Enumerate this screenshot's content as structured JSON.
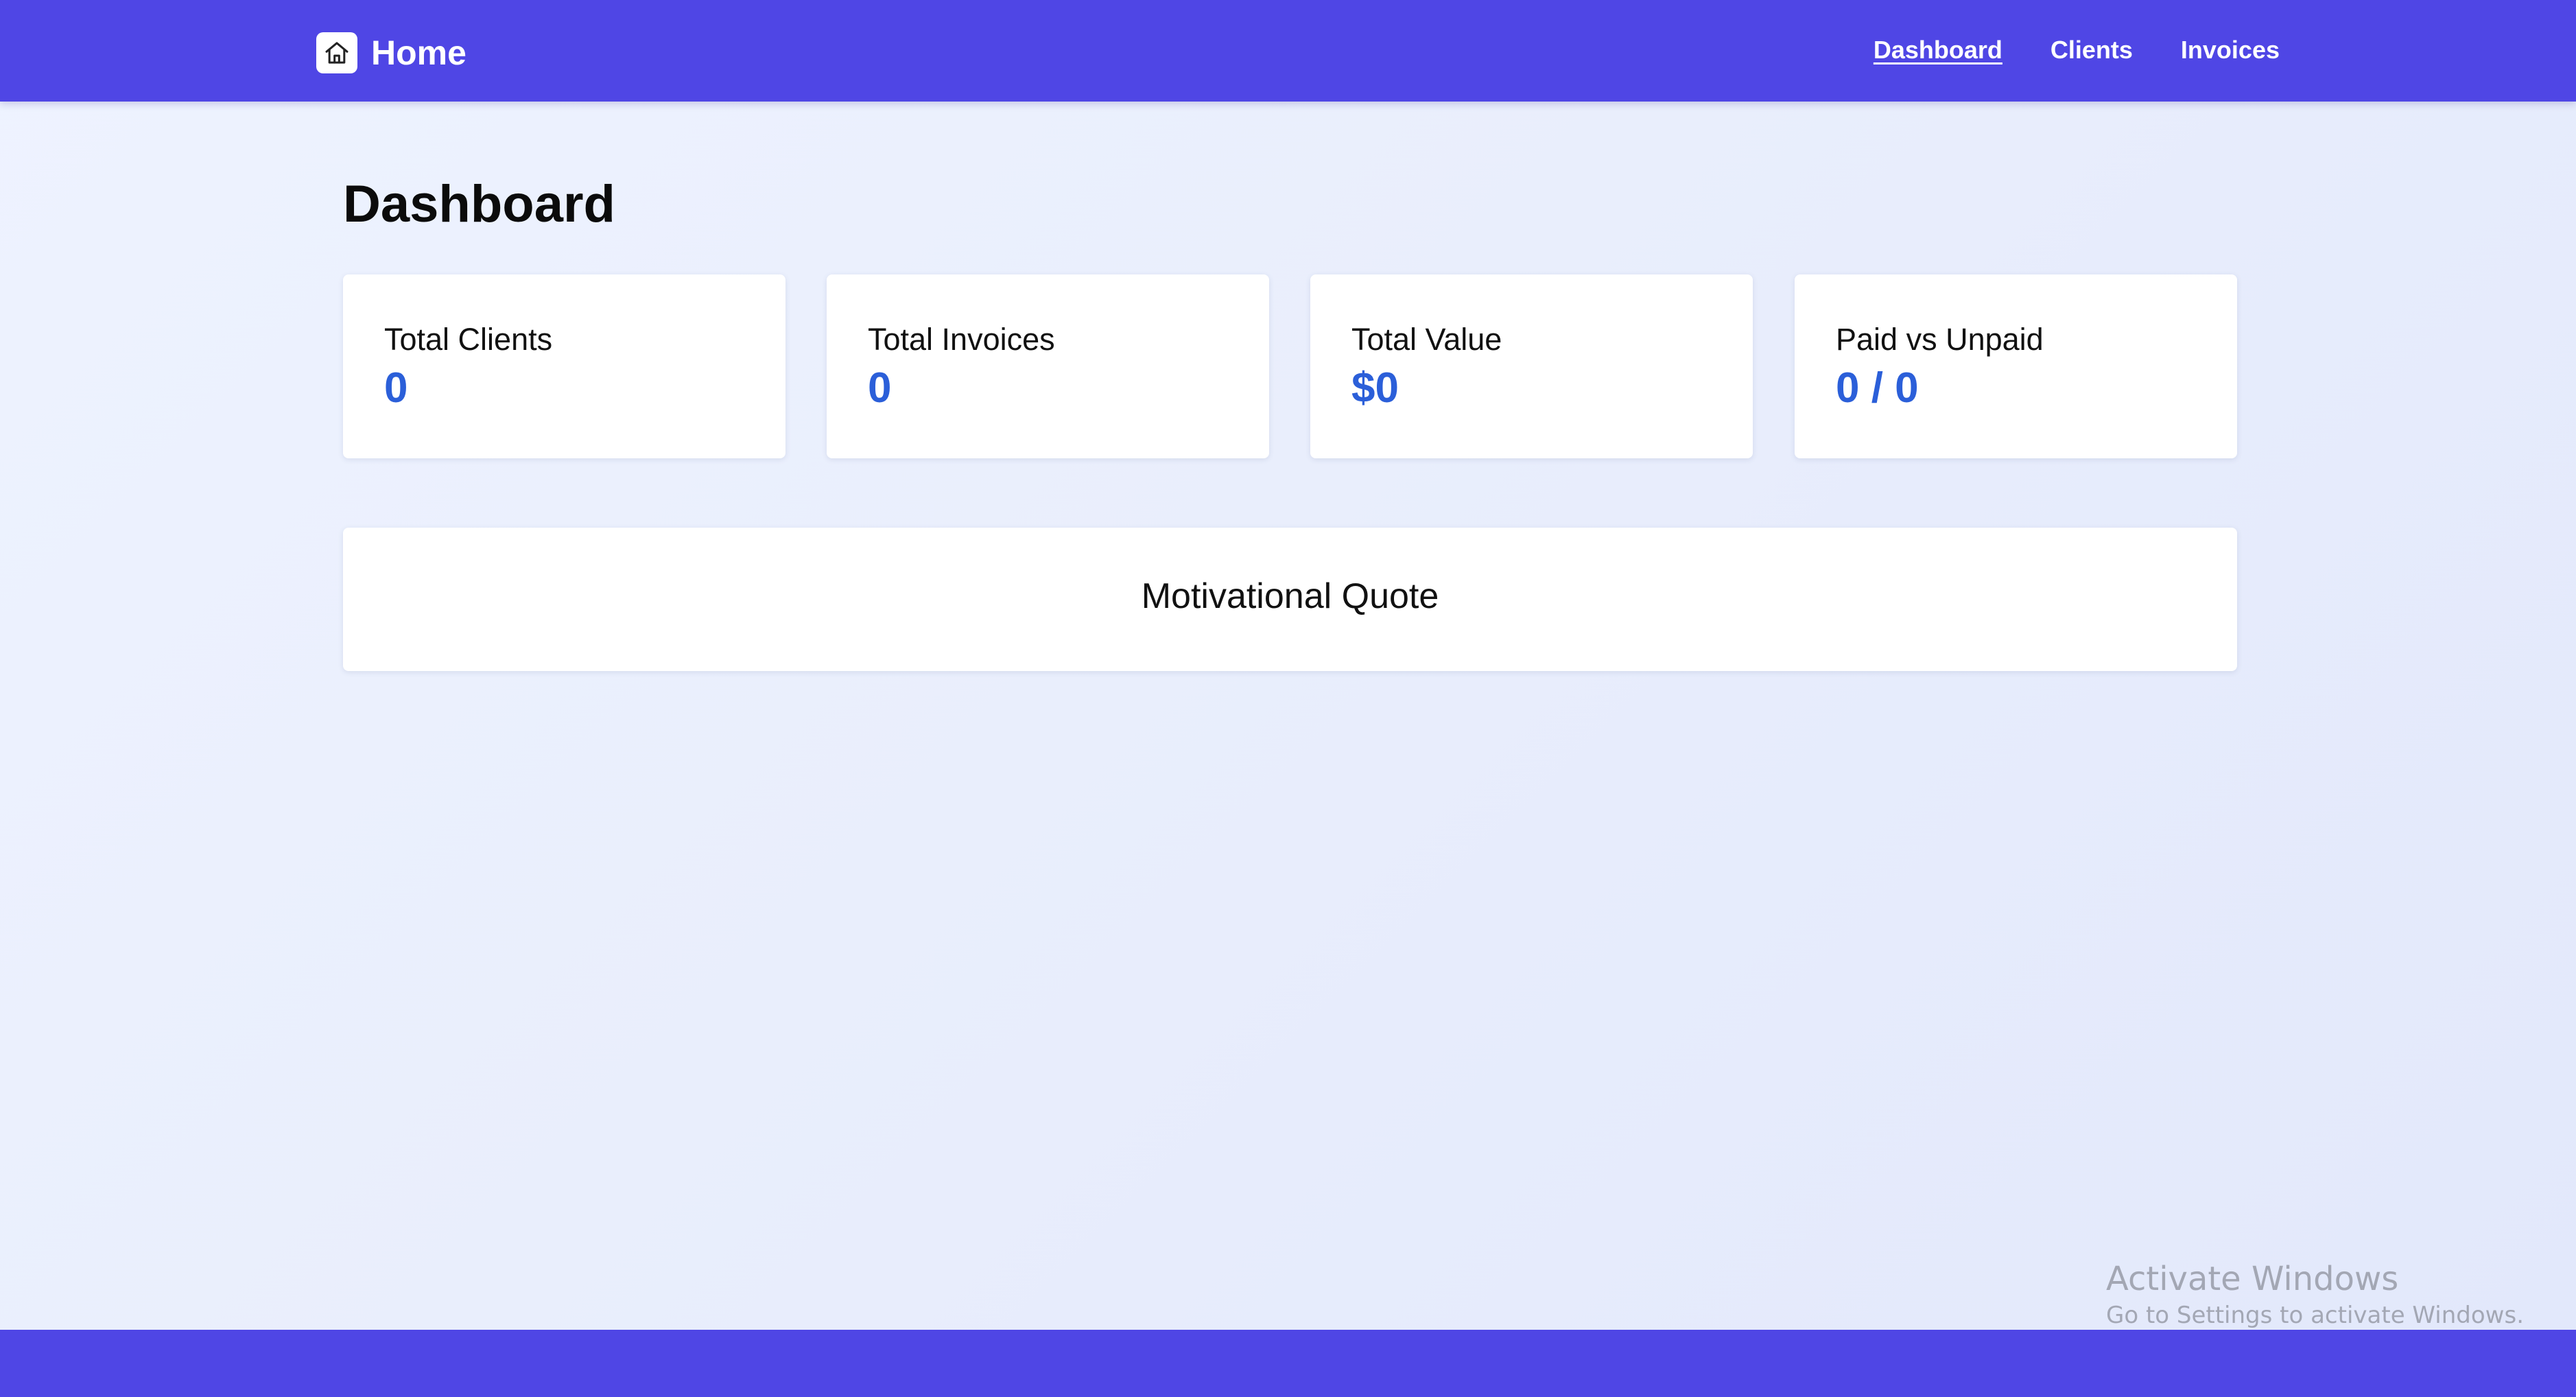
{
  "header": {
    "brand_label": "Home",
    "brand_icon": "home-icon",
    "nav": [
      {
        "label": "Dashboard",
        "active": true
      },
      {
        "label": "Clients",
        "active": false
      },
      {
        "label": "Invoices",
        "active": false
      }
    ]
  },
  "main": {
    "title": "Dashboard",
    "stats": [
      {
        "label": "Total Clients",
        "value": "0"
      },
      {
        "label": "Total Invoices",
        "value": "0"
      },
      {
        "label": "Total Value",
        "value": "$0"
      },
      {
        "label": "Paid vs Unpaid",
        "value": "0 / 0"
      }
    ],
    "quote": {
      "heading": "Motivational Quote"
    }
  },
  "watermark": {
    "title": "Activate Windows",
    "subtitle": "Go to Settings to activate Windows."
  },
  "colors": {
    "primary": "#4f46e5",
    "stat_value": "#2b5fd9",
    "card_background": "#ffffff"
  }
}
